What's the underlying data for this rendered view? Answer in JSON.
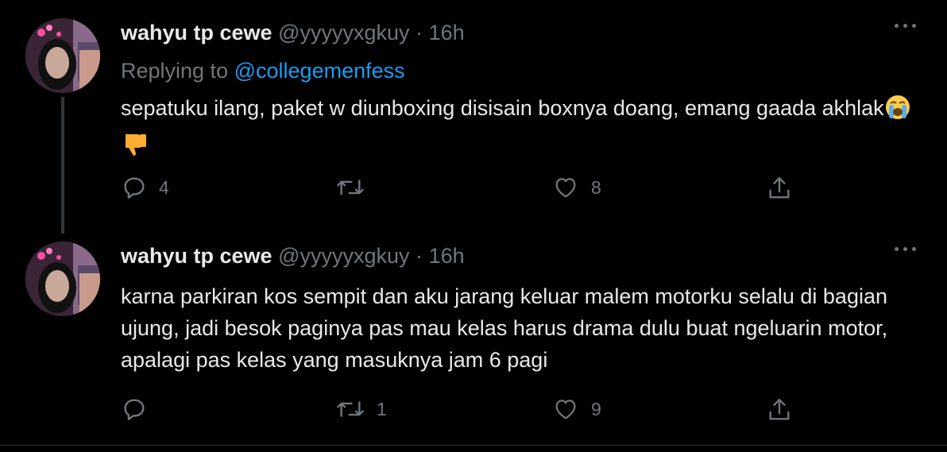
{
  "tweets": [
    {
      "name": "wahyu tp cewe",
      "handle": "@yyyyyxgkuy",
      "separator": "·",
      "time": "16h",
      "replying_prefix": "Replying to",
      "replying_to": "@collegemenfess",
      "text": "sepatuku ilang, paket w diunboxing disisain boxnya doang, emang gaada akhlak",
      "emojis": [
        "crying-face",
        "thumbs-down"
      ],
      "actions": {
        "reply_count": "4",
        "retweet_count": "",
        "like_count": "8"
      }
    },
    {
      "name": "wahyu tp cewe",
      "handle": "@yyyyyxgkuy",
      "separator": "·",
      "time": "16h",
      "text": "karna parkiran kos sempit dan aku jarang keluar malem motorku selalu di bagian ujung, jadi besok paginya pas mau kelas harus drama dulu buat ngeluarin motor, apalagi pas kelas yang masuknya jam 6 pagi",
      "actions": {
        "reply_count": "",
        "retweet_count": "1",
        "like_count": "9"
      }
    }
  ],
  "icons": {
    "reply": "reply-icon",
    "retweet": "retweet-icon",
    "like": "heart-icon",
    "share": "share-icon",
    "more": "more-icon"
  },
  "colors": {
    "background": "#000000",
    "text": "#e7e9ea",
    "muted": "#71767b",
    "link": "#1d9bf0",
    "thread_line": "#333639"
  }
}
